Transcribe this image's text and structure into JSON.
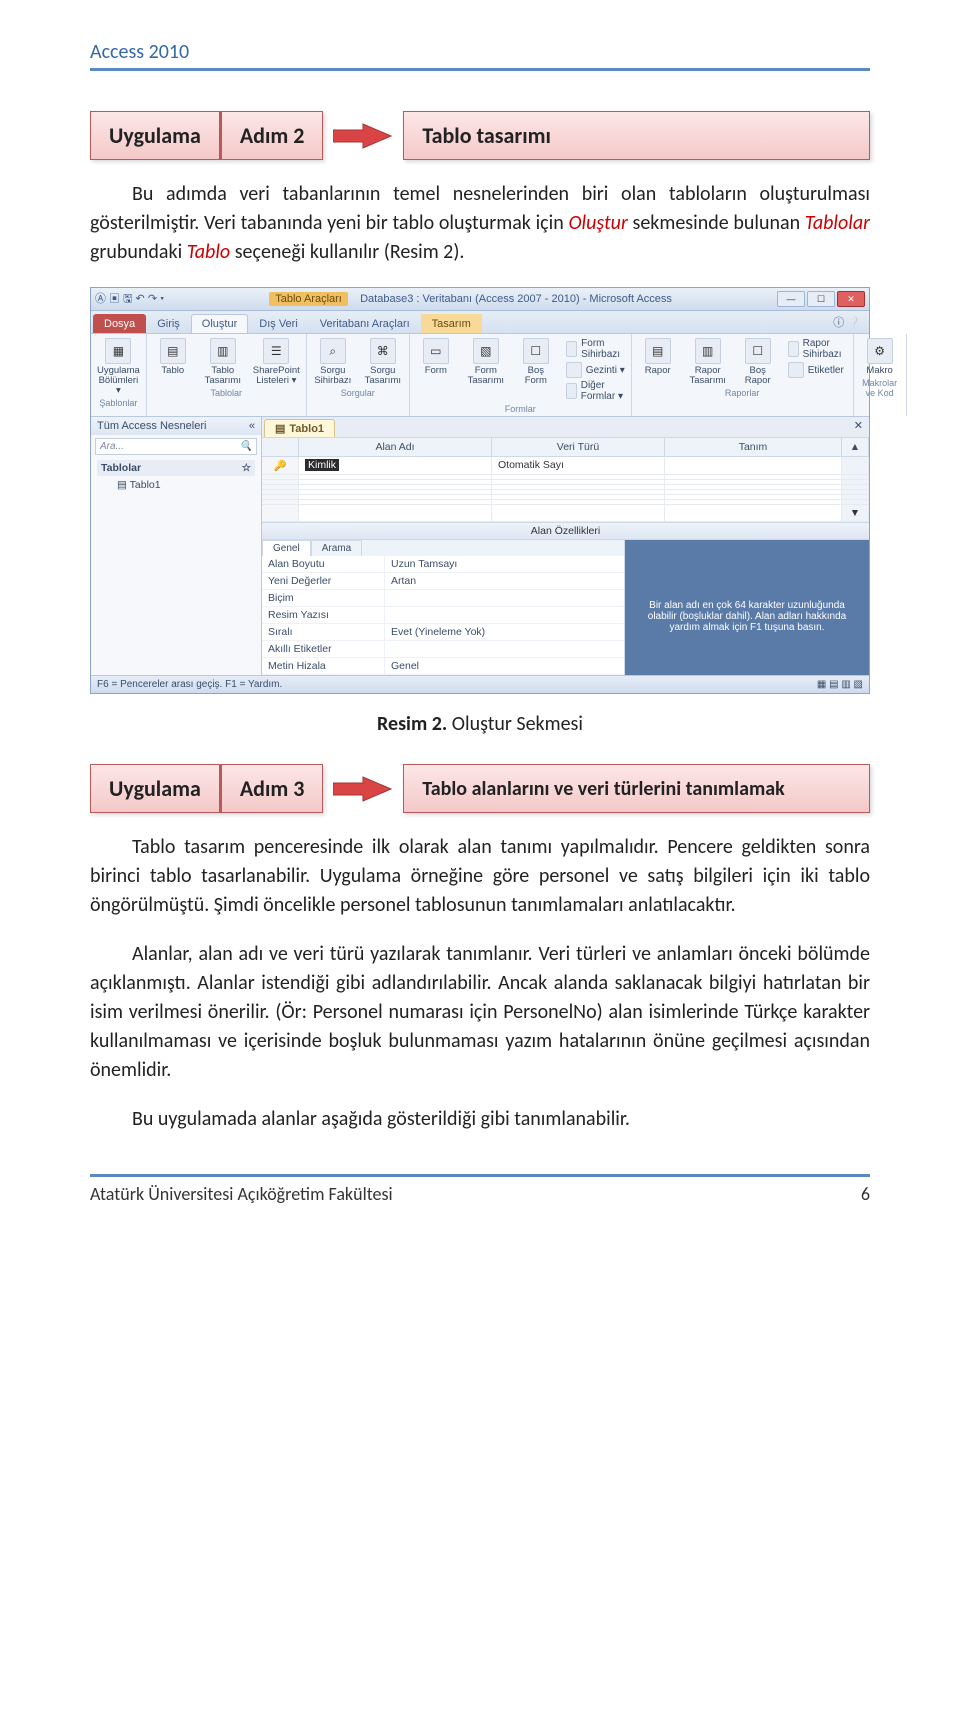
{
  "header": {
    "title": "Access 2010"
  },
  "callout1": {
    "label": "Uygulama",
    "step": "Adım 2",
    "target": "Tablo tasarımı"
  },
  "para1_a": "Bu adımda veri tabanlarının temel nesnelerinden biri olan tabloların oluşturulması gösterilmiştir. Veri tabanında yeni bir tablo oluşturmak için ",
  "para1_i1": "Oluştur",
  "para1_b": " sekmesinde bulunan ",
  "para1_i2": "Tablolar",
  "para1_c": " grubundaki ",
  "para1_i3": "Tablo",
  "para1_d": " seçeneği kullanılır (Resim 2).",
  "access": {
    "title_context": "Tablo Araçları",
    "title_main": "Database3 : Veritabanı (Access 2007 - 2010) - Microsoft Access",
    "tabs": {
      "file": "Dosya",
      "home": "Giriş",
      "create": "Oluştur",
      "external": "Dış Veri",
      "dbtools": "Veritabanı Araçları",
      "design": "Tasarım"
    },
    "groups": {
      "templates": {
        "items": [
          "Uygulama Bölümleri ▾"
        ],
        "caption": "Şablonlar"
      },
      "tables": {
        "items": [
          "Tablo",
          "Tablo Tasarımı",
          "SharePoint Listeleri ▾"
        ],
        "caption": "Tablolar"
      },
      "queries": {
        "items": [
          "Sorgu Sihirbazı",
          "Sorgu Tasarımı"
        ],
        "caption": "Sorgular"
      },
      "forms": {
        "items": [
          "Form",
          "Form Tasarımı",
          "Boş Form"
        ],
        "side": [
          "Form Sihirbazı",
          "Gezinti ▾",
          "Diğer Formlar ▾"
        ],
        "caption": "Formlar"
      },
      "reports": {
        "items": [
          "Rapor",
          "Rapor Tasarımı",
          "Boş Rapor"
        ],
        "side": [
          "Rapor Sihirbazı",
          "Etiketler"
        ],
        "caption": "Raporlar"
      },
      "macros": {
        "items": [
          "Makro"
        ],
        "caption": "Makrolar ve Kod"
      }
    },
    "nav": {
      "header": "Tüm Access Nesneleri",
      "search": "Ara...",
      "group": "Tablolar",
      "item": "Tablo1"
    },
    "objtab": "Tablo1",
    "gridheaders": {
      "name": "Alan Adı",
      "type": "Veri Türü",
      "desc": "Tanım"
    },
    "row0": {
      "name": "Kimlik",
      "type": "Otomatik Sayı"
    },
    "fieldprops_header": "Alan Özellikleri",
    "fp_tabs": {
      "general": "Genel",
      "lookup": "Arama"
    },
    "fp_rows": [
      {
        "k": "Alan Boyutu",
        "v": "Uzun Tamsayı"
      },
      {
        "k": "Yeni Değerler",
        "v": "Artan"
      },
      {
        "k": "Biçim",
        "v": ""
      },
      {
        "k": "Resim Yazısı",
        "v": ""
      },
      {
        "k": "Sıralı",
        "v": "Evet (Yineleme Yok)"
      },
      {
        "k": "Akıllı Etiketler",
        "v": ""
      },
      {
        "k": "Metin Hizala",
        "v": "Genel"
      }
    ],
    "hint": "Bir alan adı en çok 64 karakter uzunluğunda olabilir (boşluklar dahil). Alan adları hakkında yardım almak için F1 tuşuna basın.",
    "status": "F6 = Pencereler arası geçiş. F1 = Yardım."
  },
  "figcaption": {
    "bold": "Resim 2.",
    "rest": " Oluştur Sekmesi"
  },
  "callout2": {
    "label": "Uygulama",
    "step": "Adım 3",
    "target": "Tablo alanlarını ve veri türlerini tanımlamak"
  },
  "para2": "Tablo tasarım penceresinde ilk olarak alan tanımı yapılmalıdır. Pencere geldikten sonra birinci tablo tasarlanabilir. Uygulama örneğine göre personel ve satış bilgileri için iki tablo öngörülmüştü. Şimdi öncelikle personel tablosunun tanımlamaları anlatılacaktır.",
  "para3": "Alanlar, alan adı ve veri türü yazılarak tanımlanır. Veri türleri ve anlamları önceki bölümde açıklanmıştı. Alanlar istendiği gibi adlandırılabilir. Ancak alanda saklanacak bilgiyi hatırlatan bir isim verilmesi önerilir. (Ör: Personel numarası için PersonelNo) alan isimlerinde Türkçe karakter kullanılmaması ve içerisinde boşluk bulunmaması yazım hatalarının önüne geçilmesi açısından önemlidir.",
  "para4": "Bu uygulamada alanlar aşağıda gösterildiği gibi tanımlanabilir.",
  "footer": {
    "left": "Atatürk Üniversitesi Açıköğretim Fakültesi",
    "right": "6"
  }
}
